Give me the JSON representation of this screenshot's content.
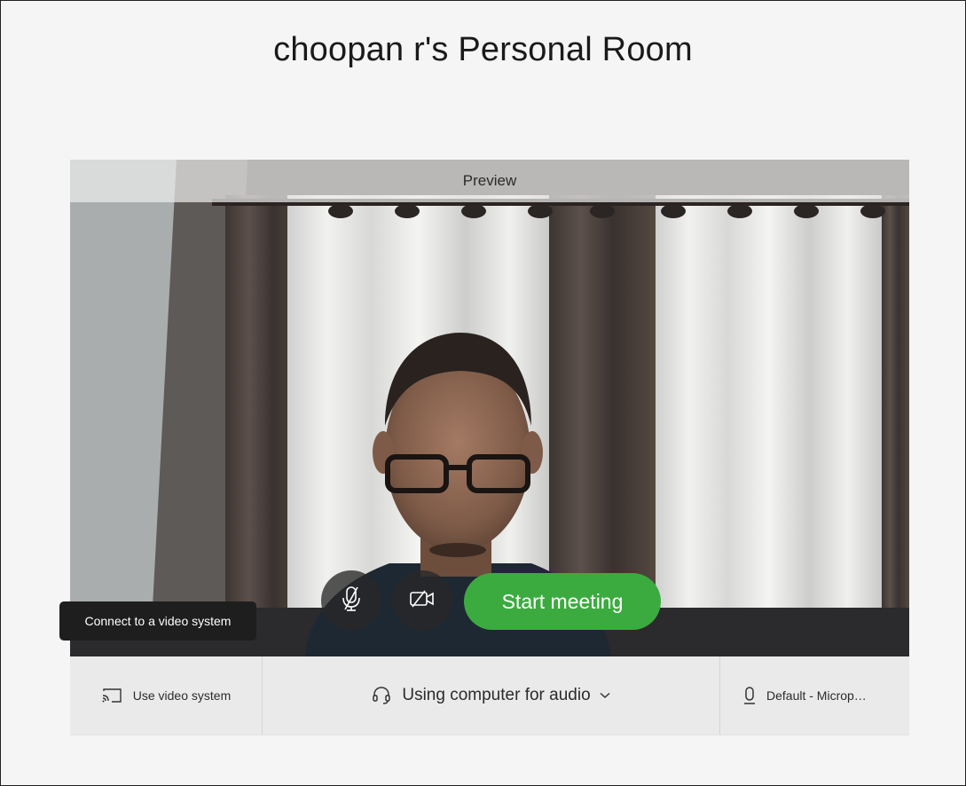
{
  "page": {
    "title": "choopan r's Personal Room"
  },
  "preview": {
    "label": "Preview"
  },
  "controls": {
    "mute_icon": "microphone-muted-icon",
    "video_icon": "video-off-icon",
    "start_label": "Start meeting"
  },
  "tooltip": {
    "text": "Connect to a video system"
  },
  "bottom_bar": {
    "video_system_label": "Use video system",
    "video_system_icon": "cast-icon",
    "audio_label": "Using computer for audio",
    "audio_icon": "headset-icon",
    "mic_label": "Default - Microp…",
    "mic_icon": "microphone-icon"
  },
  "colors": {
    "start_button": "#3bab3f",
    "background": "#f5f5f5"
  }
}
